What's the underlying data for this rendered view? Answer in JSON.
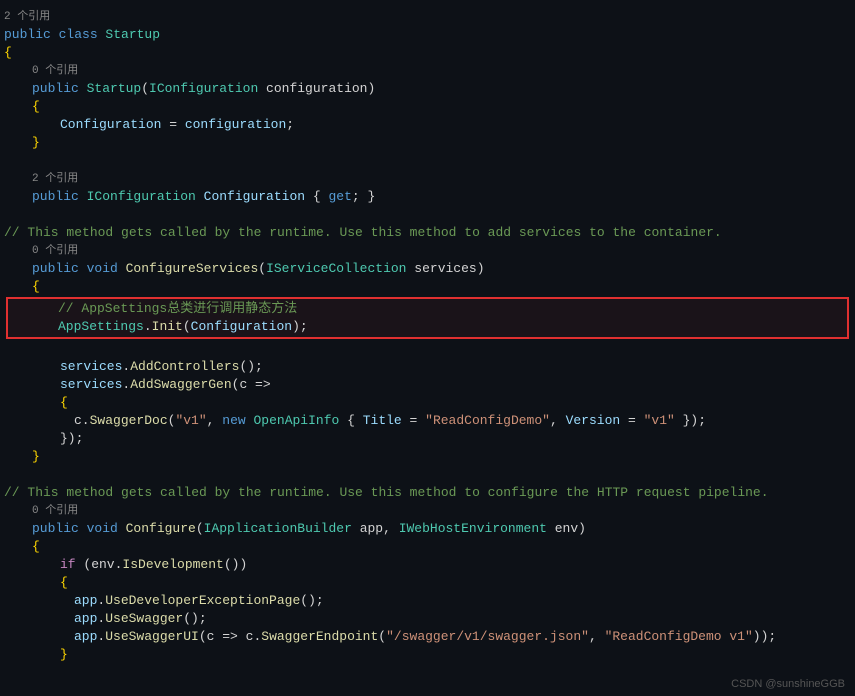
{
  "editor": {
    "background": "#0d1117",
    "lines": [
      {
        "indent": 0,
        "ref": "2 个引用",
        "content": "public class Startup",
        "type": "class-decl"
      },
      {
        "indent": 0,
        "ref": "",
        "content": "{",
        "type": "brace"
      },
      {
        "indent": 1,
        "ref": "0 个引用",
        "content": "public Startup(IConfiguration configuration)",
        "type": "constructor"
      },
      {
        "indent": 1,
        "ref": "",
        "content": "{",
        "type": "brace"
      },
      {
        "indent": 2,
        "ref": "",
        "content": "Configuration = configuration;",
        "type": "code"
      },
      {
        "indent": 1,
        "ref": "",
        "content": "}",
        "type": "brace"
      },
      {
        "indent": 0,
        "ref": "",
        "content": "",
        "type": "empty"
      },
      {
        "indent": 1,
        "ref": "2 个引用",
        "content": "public IConfiguration Configuration { get; }",
        "type": "prop"
      },
      {
        "indent": 0,
        "ref": "",
        "content": "",
        "type": "empty"
      },
      {
        "indent": 0,
        "ref": "",
        "content": "// This method gets called by the runtime. Use this method to add services to the container.",
        "type": "comment"
      },
      {
        "indent": 1,
        "ref": "0 个引用",
        "content": "public void ConfigureServices(IServiceCollection services)",
        "type": "method-decl"
      },
      {
        "indent": 1,
        "ref": "",
        "content": "{",
        "type": "brace"
      },
      {
        "indent": 2,
        "ref": "",
        "content": "// AppSettings总类进行调用静态方法",
        "type": "comment-highlighted"
      },
      {
        "indent": 2,
        "ref": "",
        "content": "AppSettings.Init(Configuration);",
        "type": "code-highlighted"
      },
      {
        "indent": 0,
        "ref": "",
        "content": "",
        "type": "empty"
      },
      {
        "indent": 2,
        "ref": "",
        "content": "services.AddControllers();",
        "type": "code"
      },
      {
        "indent": 2,
        "ref": "",
        "content": "services.AddSwaggerGen(c =>",
        "type": "code"
      },
      {
        "indent": 2,
        "ref": "",
        "content": "{",
        "type": "brace"
      },
      {
        "indent": 3,
        "ref": "",
        "content": "c.SwaggerDoc(\"v1\", new OpenApiInfo { Title = \"ReadConfigDemo\", Version = \"v1\" });",
        "type": "code"
      },
      {
        "indent": 2,
        "ref": "",
        "content": "});",
        "type": "code"
      },
      {
        "indent": 1,
        "ref": "",
        "content": "}",
        "type": "brace"
      },
      {
        "indent": 0,
        "ref": "",
        "content": "",
        "type": "empty"
      },
      {
        "indent": 0,
        "ref": "",
        "content": "// This method gets called by the runtime. Use this method to configure the HTTP request pipeline.",
        "type": "comment"
      },
      {
        "indent": 1,
        "ref": "0 个引用",
        "content": "public void Configure(IApplicationBuilder app, IWebHostEnvironment env)",
        "type": "method-decl"
      },
      {
        "indent": 1,
        "ref": "",
        "content": "{",
        "type": "brace"
      },
      {
        "indent": 2,
        "ref": "",
        "content": "if (env.IsDevelopment())",
        "type": "code"
      },
      {
        "indent": 2,
        "ref": "",
        "content": "{",
        "type": "brace"
      },
      {
        "indent": 3,
        "ref": "",
        "content": "app.UseDeveloperExceptionPage();",
        "type": "code"
      },
      {
        "indent": 3,
        "ref": "",
        "content": "app.UseSwagger();",
        "type": "code"
      },
      {
        "indent": 3,
        "ref": "",
        "content": "app.UseSwaggerUI(c => c.SwaggerEndpoint(\"/swagger/v1/swagger.json\", \"ReadConfigDemo v1\"));",
        "type": "code"
      },
      {
        "indent": 2,
        "ref": "",
        "content": "}",
        "type": "brace"
      }
    ],
    "watermark": "CSDN @sunshineGGB"
  }
}
